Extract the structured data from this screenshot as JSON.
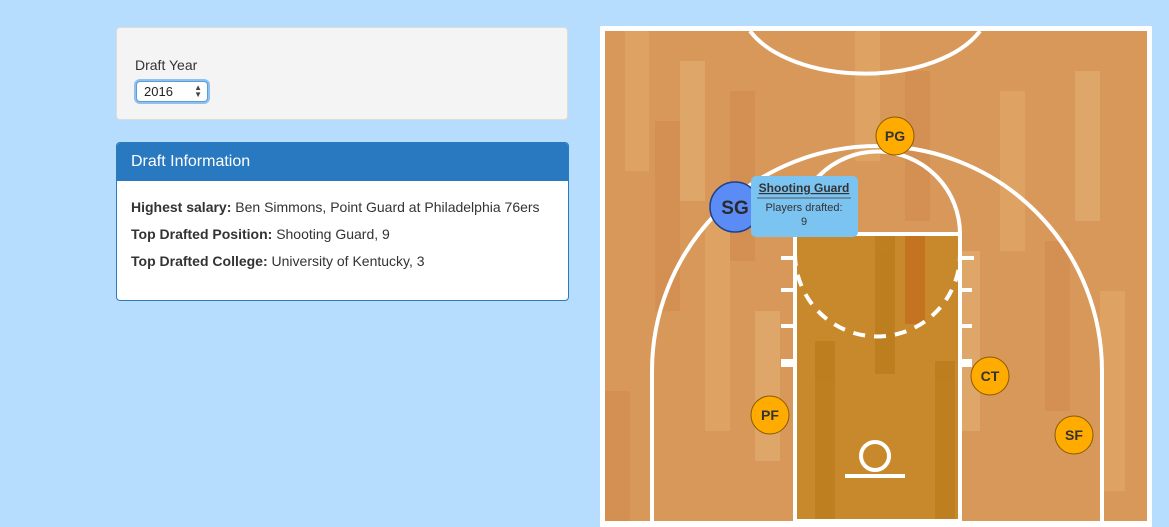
{
  "draft_year": {
    "label": "Draft Year",
    "selected": "2016"
  },
  "draft_info": {
    "title": "Draft Information",
    "rows": [
      {
        "label": "Highest salary:",
        "value": "Ben Simmons, Point Guard at Philadelphia 76ers"
      },
      {
        "label": "Top Drafted Position:",
        "value": "Shooting Guard, 9"
      },
      {
        "label": "Top Drafted College:",
        "value": "University of Kentucky, 3"
      }
    ]
  },
  "court": {
    "positions": [
      {
        "abbr": "PG",
        "color": "#ffab00"
      },
      {
        "abbr": "SG",
        "color": "#5b8cf5"
      },
      {
        "abbr": "CT",
        "color": "#ffab00"
      },
      {
        "abbr": "PF",
        "color": "#ffab00"
      },
      {
        "abbr": "SF",
        "color": "#ffab00"
      }
    ],
    "tooltip": {
      "title": "Shooting Guard",
      "line": "Players drafted:",
      "value": "9"
    }
  },
  "colors": {
    "page_bg": "#b6dcfe",
    "panel_heading": "#2879c0",
    "court_wood": "#d99a5c",
    "paint": "#c88a2e"
  }
}
